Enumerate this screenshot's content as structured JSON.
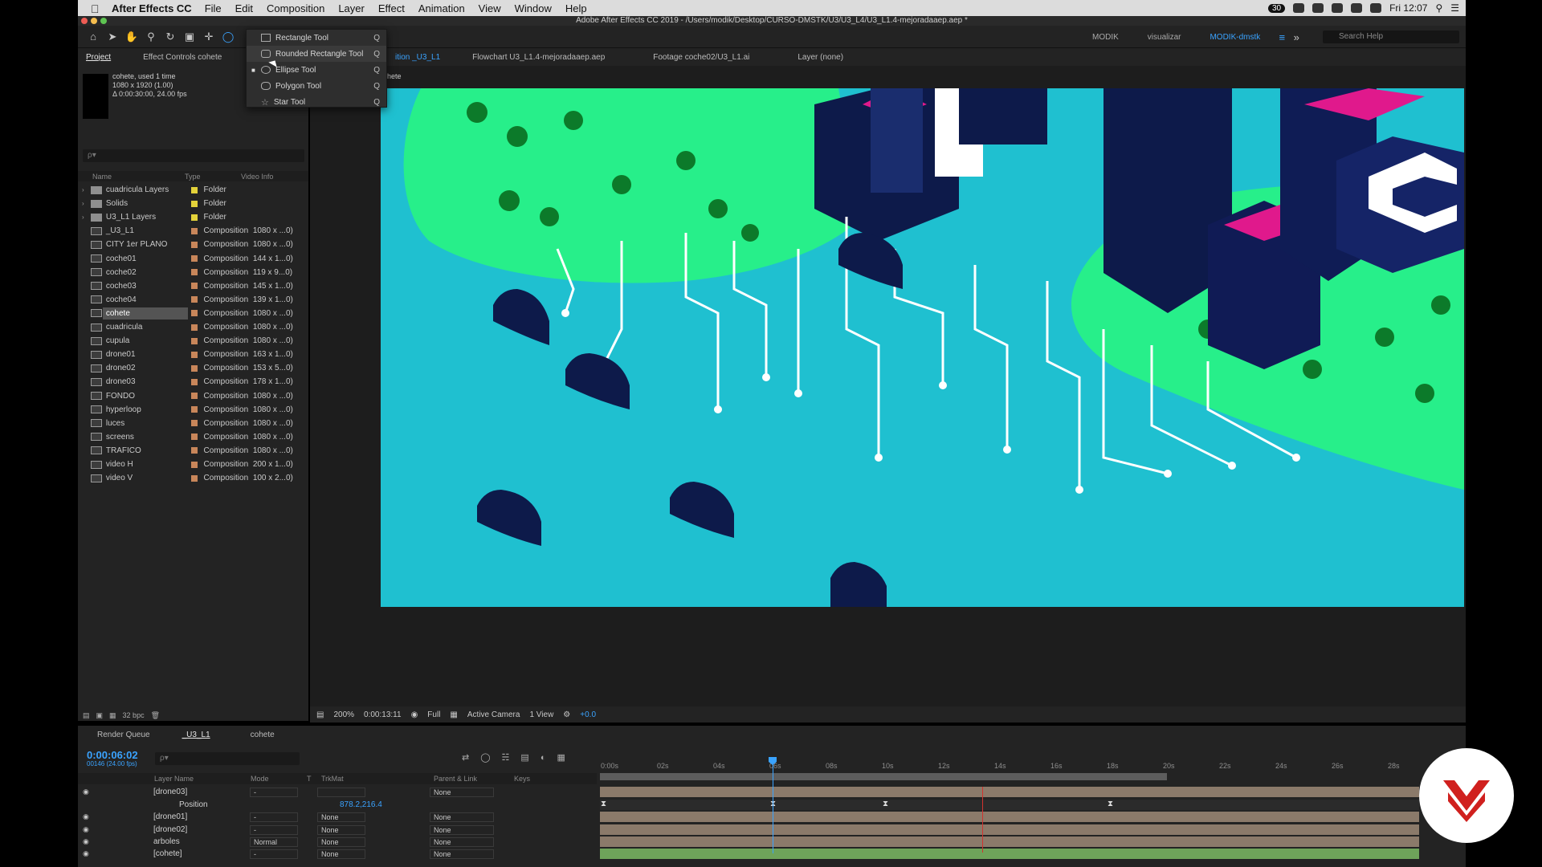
{
  "menubar": {
    "app": "After Effects CC",
    "items": [
      "File",
      "Edit",
      "Composition",
      "Layer",
      "Effect",
      "Animation",
      "View",
      "Window",
      "Help"
    ],
    "clock": "Fri 12:07",
    "badge": "30"
  },
  "window": {
    "title": "Adobe After Effects CC 2019 - /Users/modik/Desktop/CURSO-DMSTK/U3/U3_L4/U3_L1.4-mejoradaaep.aep *"
  },
  "workspaces": [
    "MODIK",
    "visualizar",
    "MODIK-dmstk"
  ],
  "help": {
    "placeholder": "Search Help"
  },
  "tool_dropdown": [
    {
      "label": "Rectangle Tool",
      "key": "Q"
    },
    {
      "label": "Rounded Rectangle Tool",
      "key": "Q"
    },
    {
      "label": "Ellipse Tool",
      "key": "Q"
    },
    {
      "label": "Polygon Tool",
      "key": "Q"
    },
    {
      "label": "Star Tool",
      "key": "Q"
    }
  ],
  "project": {
    "tab": "Project",
    "effect_tab": "Effect Controls cohete",
    "selected_name": "cohete",
    "used": ", used 1 time",
    "dims": "1080 x 1920 (1.00)",
    "duration": "Δ 0:00:30:00, 24.00 fps",
    "search_placeholder": "ρ▾",
    "cols": {
      "name": "Name",
      "type": "Type",
      "info": "Video Info"
    },
    "items": [
      {
        "name": "cuadricula Layers",
        "type": "Folder",
        "size": "",
        "kind": "folder",
        "color": "#e3d23a"
      },
      {
        "name": "Solids",
        "type": "Folder",
        "size": "",
        "kind": "folder",
        "color": "#e3d23a"
      },
      {
        "name": "U3_L1 Layers",
        "type": "Folder",
        "size": "",
        "kind": "folder",
        "color": "#e3d23a"
      },
      {
        "name": "_U3_L1",
        "type": "Composition",
        "size": "1080 x ...0)",
        "kind": "comp",
        "color": "#c8865a"
      },
      {
        "name": "CITY 1er PLANO",
        "type": "Composition",
        "size": "1080 x ...0)",
        "kind": "comp",
        "color": "#c8865a"
      },
      {
        "name": "coche01",
        "type": "Composition",
        "size": "144 x 1...0)",
        "kind": "comp",
        "color": "#c8865a"
      },
      {
        "name": "coche02",
        "type": "Composition",
        "size": "119 x 9...0)",
        "kind": "comp",
        "color": "#c8865a"
      },
      {
        "name": "coche03",
        "type": "Composition",
        "size": "145 x 1...0)",
        "kind": "comp",
        "color": "#c8865a"
      },
      {
        "name": "coche04",
        "type": "Composition",
        "size": "139 x 1...0)",
        "kind": "comp",
        "color": "#c8865a"
      },
      {
        "name": "cohete",
        "type": "Composition",
        "size": "1080 x ...0)",
        "kind": "comp",
        "color": "#c8865a"
      },
      {
        "name": "cuadricula",
        "type": "Composition",
        "size": "1080 x ...0)",
        "kind": "comp",
        "color": "#c8865a"
      },
      {
        "name": "cupula",
        "type": "Composition",
        "size": "1080 x ...0)",
        "kind": "comp",
        "color": "#c8865a"
      },
      {
        "name": "drone01",
        "type": "Composition",
        "size": "163 x 1...0)",
        "kind": "comp",
        "color": "#c8865a"
      },
      {
        "name": "drone02",
        "type": "Composition",
        "size": "153 x 5...0)",
        "kind": "comp",
        "color": "#c8865a"
      },
      {
        "name": "drone03",
        "type": "Composition",
        "size": "178 x 1...0)",
        "kind": "comp",
        "color": "#c8865a"
      },
      {
        "name": "FONDO",
        "type": "Composition",
        "size": "1080 x ...0)",
        "kind": "comp",
        "color": "#c8865a"
      },
      {
        "name": "hyperloop",
        "type": "Composition",
        "size": "1080 x ...0)",
        "kind": "comp",
        "color": "#c8865a"
      },
      {
        "name": "luces",
        "type": "Composition",
        "size": "1080 x ...0)",
        "kind": "comp",
        "color": "#c8865a"
      },
      {
        "name": "screens",
        "type": "Composition",
        "size": "1080 x ...0)",
        "kind": "comp",
        "color": "#c8865a"
      },
      {
        "name": "TRAFICO",
        "type": "Composition",
        "size": "1080 x ...0)",
        "kind": "comp",
        "color": "#c8865a"
      },
      {
        "name": "video H",
        "type": "Composition",
        "size": "200 x 1...0)",
        "kind": "comp",
        "color": "#c8865a"
      },
      {
        "name": "video V",
        "type": "Composition",
        "size": "100 x 2...0)",
        "kind": "comp",
        "color": "#c8865a"
      }
    ],
    "bpc": "32 bpc"
  },
  "viewer": {
    "tabs": [
      "ition _U3_L1",
      "Flowchart U3_L1.4-mejoradaaep.aep",
      "Footage coche02/U3_L1.ai",
      "Layer (none)"
    ],
    "breadcrumb": "hete",
    "zoom": "200%",
    "timecode": "0:00:13:11",
    "resolution": "Full",
    "camera": "Active Camera",
    "views": "1 View",
    "exposure": "+0.0"
  },
  "timeline": {
    "tabs": [
      "Render Queue",
      "_U3_L1",
      "cohete"
    ],
    "timecode": "0:00:06:02",
    "fps": "00146 (24.00 fps)",
    "search_placeholder": "ρ▾",
    "cols": {
      "name": "Layer Name",
      "mode": "Mode",
      "t": "T",
      "trkmat": "TrkMat",
      "parent": "Parent & Link",
      "keys": "Keys"
    },
    "ruler": [
      "0:00s",
      "02s",
      "04s",
      "06s",
      "08s",
      "10s",
      "12s",
      "14s",
      "16s",
      "18s",
      "20s",
      "22s",
      "24s",
      "26s",
      "28s"
    ],
    "layers": [
      {
        "name": "[drone03]",
        "mode": "-",
        "trk": "",
        "parent": "None"
      },
      {
        "name": "Position",
        "mode": "",
        "trk": "",
        "parent": "",
        "value": "878.2,216.4"
      },
      {
        "name": "[drone01]",
        "mode": "-",
        "trk": "None",
        "parent": "None"
      },
      {
        "name": "[drone02]",
        "mode": "-",
        "trk": "None",
        "parent": "None"
      },
      {
        "name": "arboles",
        "mode": "Normal",
        "trk": "None",
        "parent": "None"
      },
      {
        "name": "[cohete]",
        "mode": "-",
        "trk": "None",
        "parent": "None"
      }
    ]
  }
}
